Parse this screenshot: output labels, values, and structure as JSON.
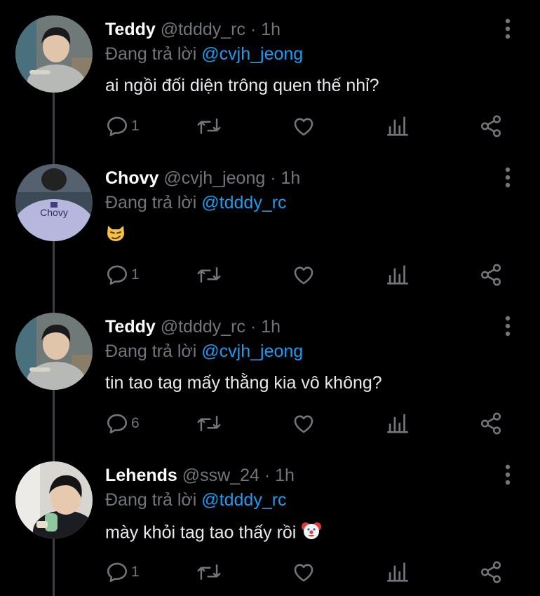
{
  "reply_prefix": "Đang trả lời",
  "dot": "·",
  "tweets": [
    {
      "name": "Teddy",
      "handle": "@tdddy_rc",
      "time": "1h",
      "reply_to": "@cvjh_jeong",
      "text": "ai ngồi đối diện trông quen thế nhỉ?",
      "reply_count": "1"
    },
    {
      "name": "Chovy",
      "handle": "@cvjh_jeong",
      "time": "1h",
      "reply_to": "@tdddy_rc",
      "text": "",
      "emoji": "smirking-cat-emoji",
      "reply_count": "1",
      "avatar_shirt_text": "Chovy"
    },
    {
      "name": "Teddy",
      "handle": "@tdddy_rc",
      "time": "1h",
      "reply_to": "@cvjh_jeong",
      "text": "tin tao tag mấy thằng kia vô không?",
      "reply_count": "6"
    },
    {
      "name": "Lehends",
      "handle": "@ssw_24",
      "time": "1h",
      "reply_to": "@tdddy_rc",
      "text": "mày khỏi tag tao thấy rồi",
      "emoji": "clown-face-emoji",
      "reply_count": "1"
    }
  ],
  "colors": {
    "background": "#000000",
    "name": "#ffffff",
    "muted": "#71767b",
    "mention": "#1d9bf0",
    "thread_line": "#3a3d40"
  },
  "icons": [
    "reply-icon",
    "retweet-icon",
    "like-icon",
    "analytics-icon",
    "share-icon",
    "more-options-icon"
  ]
}
